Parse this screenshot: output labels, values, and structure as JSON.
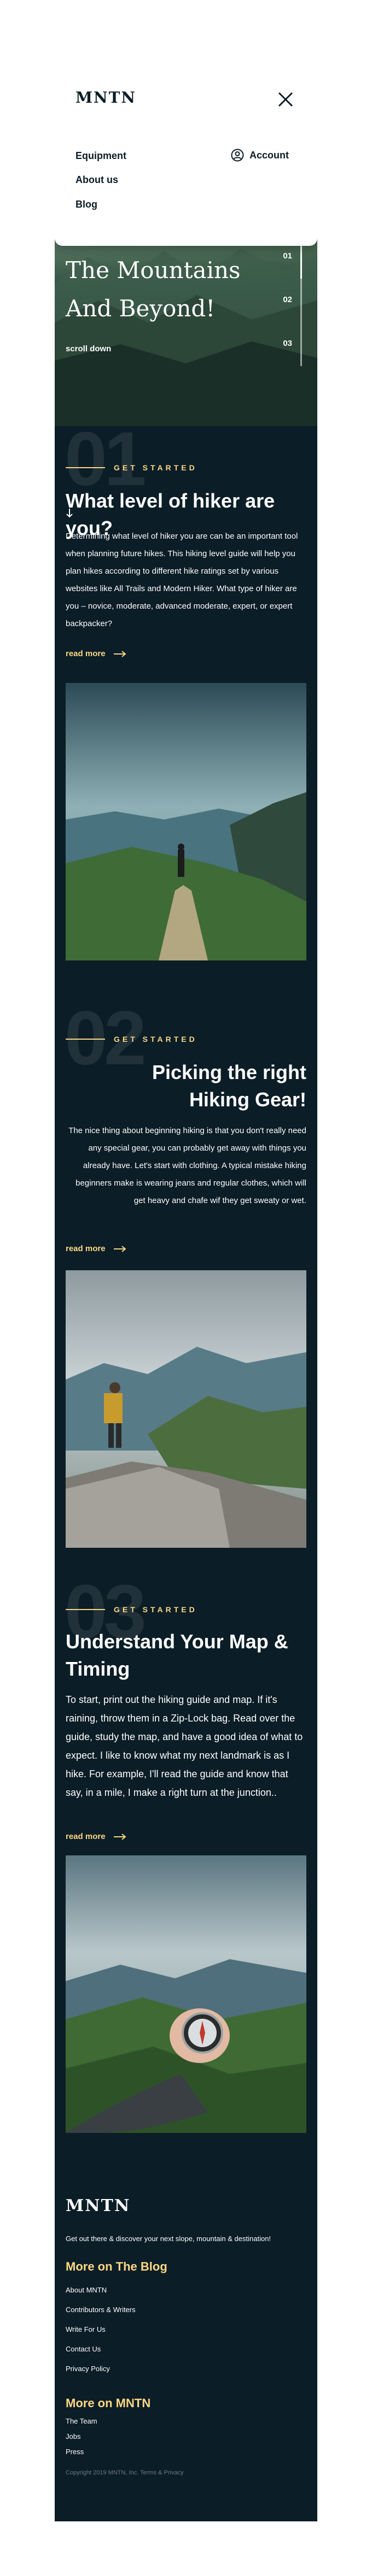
{
  "nav": {
    "logo": "MNTN",
    "links": [
      "Equipment",
      "About us",
      "Blog"
    ],
    "account_label": "Account"
  },
  "hero": {
    "title_line1": "The Mountains",
    "title_line2": "And Beyond!",
    "scroll_label": "scroll down",
    "indicator": [
      "01",
      "02",
      "03"
    ]
  },
  "sections": [
    {
      "number": "01",
      "eyebrow": "GET STARTED",
      "title": "What level of  hiker are you?",
      "body": "Determining what level of hiker you are can be an important tool when planning future hikes. This hiking level guide will help you plan hikes according to different hike ratings set by various websites like All Trails and Modern Hiker. What type of hiker are you – novice, moderate, advanced moderate, expert, or expert backpacker?",
      "read_more": "read more"
    },
    {
      "number": "02",
      "eyebrow": "GET STARTED",
      "title": "Picking the right Hiking Gear!",
      "body": "The nice thing about beginning hiking is that you don't really need any special gear, you can probably get away with things you already have. Let's start with clothing. A typical mistake hiking beginners make is wearing jeans and regular clothes, which will get heavy and chafe wif they get sweaty or wet.",
      "read_more": "read more"
    },
    {
      "number": "03",
      "eyebrow": "GET STARTED",
      "title": "Understand Your Map & Timing",
      "body": "To start, print out the hiking guide and map. If it's raining, throw them in a Zip-Lock bag. Read over the guide, study the map, and have a good idea of what to expect. I like to know what my next landmark is as I hike. For example, I'll read the guide and know that say, in a mile, I make a right turn at the junction..",
      "read_more": "read more"
    }
  ],
  "footer": {
    "logo": "MNTN",
    "tagline": "Get out there & discover your next slope, mountain & destination!",
    "blog_heading": "More on The Blog",
    "blog_links": [
      "About MNTN",
      "Contributors & Writers",
      "Write For Us",
      "Contact Us",
      "Privacy Policy"
    ],
    "mntn_heading": "More on MNTN",
    "mntn_links": [
      "The Team",
      "Jobs",
      "Press"
    ],
    "copyright": "Copyright 2019 MNTN, Inc. Terms & Privacy"
  },
  "colors": {
    "accent": "#fbd784",
    "background": "#0b1d26",
    "card": "#ffffff"
  }
}
